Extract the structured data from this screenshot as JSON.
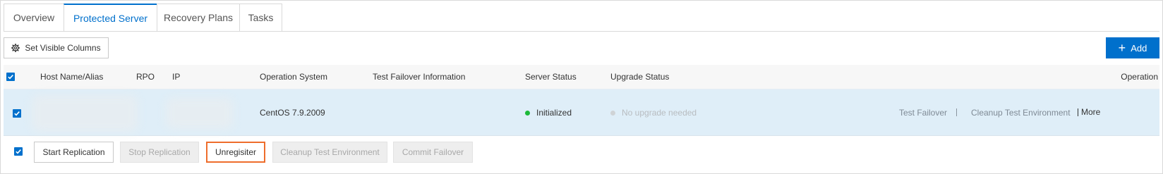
{
  "tabs": [
    "Overview",
    "Protected Server",
    "Recovery Plans",
    "Tasks"
  ],
  "toolbar": {
    "set_columns_label": "Set Visible Columns",
    "add_label": "Add"
  },
  "table": {
    "headers": {
      "host": "Host Name/Alias",
      "rpo": "RPO",
      "ip": "IP",
      "os": "Operation System",
      "test_failover": "Test Failover Information",
      "server_status": "Server Status",
      "upgrade_status": "Upgrade Status",
      "operation": "Operation"
    },
    "rows": [
      {
        "os": "CentOS 7.9.2009",
        "server_status": "Initialized",
        "upgrade_status": "No upgrade needed",
        "actions": {
          "test_failover": "Test Failover",
          "cleanup": "Cleanup Test Environment",
          "more": "More"
        }
      }
    ]
  },
  "batch_actions": {
    "start": "Start Replication",
    "stop": "Stop Replication",
    "unregister": "Unregisiter",
    "cleanup": "Cleanup Test Environment",
    "commit": "Commit Failover"
  },
  "colors": {
    "accent": "#0070cc",
    "status_ok": "#1db93a",
    "status_muted": "#cfd3d6",
    "highlight": "#ee6d2c"
  }
}
